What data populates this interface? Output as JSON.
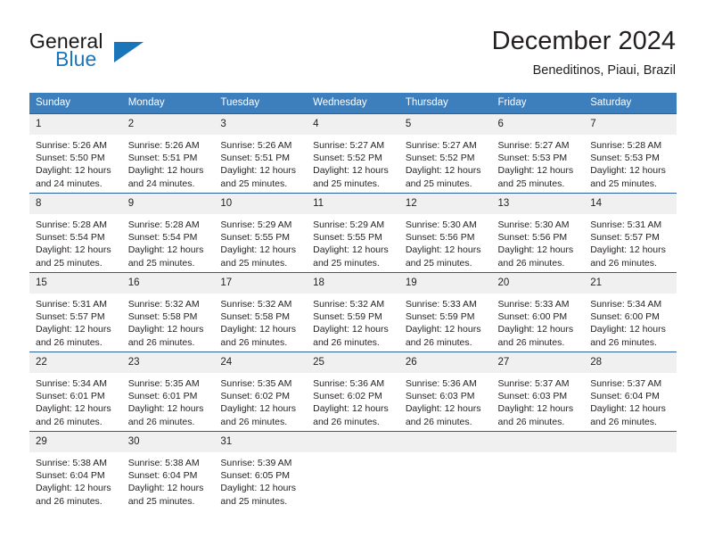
{
  "brand": {
    "name_part1": "General",
    "name_part2": "Blue",
    "triangle_color": "#1b75bb"
  },
  "header": {
    "title": "December 2024",
    "location": "Beneditinos, Piaui, Brazil"
  },
  "theme": {
    "header_row_bg": "#3d7ebd",
    "row_divider": "#2a6099",
    "daynum_bg": "#f0f0f0",
    "text": "#231f20"
  },
  "weekday_headers": [
    "Sunday",
    "Monday",
    "Tuesday",
    "Wednesday",
    "Thursday",
    "Friday",
    "Saturday"
  ],
  "weeks": [
    [
      {
        "day": "1",
        "sunrise": "Sunrise: 5:26 AM",
        "sunset": "Sunset: 5:50 PM",
        "daylight_line1": "Daylight: 12 hours",
        "daylight_line2": "and 24 minutes."
      },
      {
        "day": "2",
        "sunrise": "Sunrise: 5:26 AM",
        "sunset": "Sunset: 5:51 PM",
        "daylight_line1": "Daylight: 12 hours",
        "daylight_line2": "and 24 minutes."
      },
      {
        "day": "3",
        "sunrise": "Sunrise: 5:26 AM",
        "sunset": "Sunset: 5:51 PM",
        "daylight_line1": "Daylight: 12 hours",
        "daylight_line2": "and 25 minutes."
      },
      {
        "day": "4",
        "sunrise": "Sunrise: 5:27 AM",
        "sunset": "Sunset: 5:52 PM",
        "daylight_line1": "Daylight: 12 hours",
        "daylight_line2": "and 25 minutes."
      },
      {
        "day": "5",
        "sunrise": "Sunrise: 5:27 AM",
        "sunset": "Sunset: 5:52 PM",
        "daylight_line1": "Daylight: 12 hours",
        "daylight_line2": "and 25 minutes."
      },
      {
        "day": "6",
        "sunrise": "Sunrise: 5:27 AM",
        "sunset": "Sunset: 5:53 PM",
        "daylight_line1": "Daylight: 12 hours",
        "daylight_line2": "and 25 minutes."
      },
      {
        "day": "7",
        "sunrise": "Sunrise: 5:28 AM",
        "sunset": "Sunset: 5:53 PM",
        "daylight_line1": "Daylight: 12 hours",
        "daylight_line2": "and 25 minutes."
      }
    ],
    [
      {
        "day": "8",
        "sunrise": "Sunrise: 5:28 AM",
        "sunset": "Sunset: 5:54 PM",
        "daylight_line1": "Daylight: 12 hours",
        "daylight_line2": "and 25 minutes."
      },
      {
        "day": "9",
        "sunrise": "Sunrise: 5:28 AM",
        "sunset": "Sunset: 5:54 PM",
        "daylight_line1": "Daylight: 12 hours",
        "daylight_line2": "and 25 minutes."
      },
      {
        "day": "10",
        "sunrise": "Sunrise: 5:29 AM",
        "sunset": "Sunset: 5:55 PM",
        "daylight_line1": "Daylight: 12 hours",
        "daylight_line2": "and 25 minutes."
      },
      {
        "day": "11",
        "sunrise": "Sunrise: 5:29 AM",
        "sunset": "Sunset: 5:55 PM",
        "daylight_line1": "Daylight: 12 hours",
        "daylight_line2": "and 25 minutes."
      },
      {
        "day": "12",
        "sunrise": "Sunrise: 5:30 AM",
        "sunset": "Sunset: 5:56 PM",
        "daylight_line1": "Daylight: 12 hours",
        "daylight_line2": "and 25 minutes."
      },
      {
        "day": "13",
        "sunrise": "Sunrise: 5:30 AM",
        "sunset": "Sunset: 5:56 PM",
        "daylight_line1": "Daylight: 12 hours",
        "daylight_line2": "and 26 minutes."
      },
      {
        "day": "14",
        "sunrise": "Sunrise: 5:31 AM",
        "sunset": "Sunset: 5:57 PM",
        "daylight_line1": "Daylight: 12 hours",
        "daylight_line2": "and 26 minutes."
      }
    ],
    [
      {
        "day": "15",
        "sunrise": "Sunrise: 5:31 AM",
        "sunset": "Sunset: 5:57 PM",
        "daylight_line1": "Daylight: 12 hours",
        "daylight_line2": "and 26 minutes."
      },
      {
        "day": "16",
        "sunrise": "Sunrise: 5:32 AM",
        "sunset": "Sunset: 5:58 PM",
        "daylight_line1": "Daylight: 12 hours",
        "daylight_line2": "and 26 minutes."
      },
      {
        "day": "17",
        "sunrise": "Sunrise: 5:32 AM",
        "sunset": "Sunset: 5:58 PM",
        "daylight_line1": "Daylight: 12 hours",
        "daylight_line2": "and 26 minutes."
      },
      {
        "day": "18",
        "sunrise": "Sunrise: 5:32 AM",
        "sunset": "Sunset: 5:59 PM",
        "daylight_line1": "Daylight: 12 hours",
        "daylight_line2": "and 26 minutes."
      },
      {
        "day": "19",
        "sunrise": "Sunrise: 5:33 AM",
        "sunset": "Sunset: 5:59 PM",
        "daylight_line1": "Daylight: 12 hours",
        "daylight_line2": "and 26 minutes."
      },
      {
        "day": "20",
        "sunrise": "Sunrise: 5:33 AM",
        "sunset": "Sunset: 6:00 PM",
        "daylight_line1": "Daylight: 12 hours",
        "daylight_line2": "and 26 minutes."
      },
      {
        "day": "21",
        "sunrise": "Sunrise: 5:34 AM",
        "sunset": "Sunset: 6:00 PM",
        "daylight_line1": "Daylight: 12 hours",
        "daylight_line2": "and 26 minutes."
      }
    ],
    [
      {
        "day": "22",
        "sunrise": "Sunrise: 5:34 AM",
        "sunset": "Sunset: 6:01 PM",
        "daylight_line1": "Daylight: 12 hours",
        "daylight_line2": "and 26 minutes."
      },
      {
        "day": "23",
        "sunrise": "Sunrise: 5:35 AM",
        "sunset": "Sunset: 6:01 PM",
        "daylight_line1": "Daylight: 12 hours",
        "daylight_line2": "and 26 minutes."
      },
      {
        "day": "24",
        "sunrise": "Sunrise: 5:35 AM",
        "sunset": "Sunset: 6:02 PM",
        "daylight_line1": "Daylight: 12 hours",
        "daylight_line2": "and 26 minutes."
      },
      {
        "day": "25",
        "sunrise": "Sunrise: 5:36 AM",
        "sunset": "Sunset: 6:02 PM",
        "daylight_line1": "Daylight: 12 hours",
        "daylight_line2": "and 26 minutes."
      },
      {
        "day": "26",
        "sunrise": "Sunrise: 5:36 AM",
        "sunset": "Sunset: 6:03 PM",
        "daylight_line1": "Daylight: 12 hours",
        "daylight_line2": "and 26 minutes."
      },
      {
        "day": "27",
        "sunrise": "Sunrise: 5:37 AM",
        "sunset": "Sunset: 6:03 PM",
        "daylight_line1": "Daylight: 12 hours",
        "daylight_line2": "and 26 minutes."
      },
      {
        "day": "28",
        "sunrise": "Sunrise: 5:37 AM",
        "sunset": "Sunset: 6:04 PM",
        "daylight_line1": "Daylight: 12 hours",
        "daylight_line2": "and 26 minutes."
      }
    ],
    [
      {
        "day": "29",
        "sunrise": "Sunrise: 5:38 AM",
        "sunset": "Sunset: 6:04 PM",
        "daylight_line1": "Daylight: 12 hours",
        "daylight_line2": "and 26 minutes."
      },
      {
        "day": "30",
        "sunrise": "Sunrise: 5:38 AM",
        "sunset": "Sunset: 6:04 PM",
        "daylight_line1": "Daylight: 12 hours",
        "daylight_line2": "and 25 minutes."
      },
      {
        "day": "31",
        "sunrise": "Sunrise: 5:39 AM",
        "sunset": "Sunset: 6:05 PM",
        "daylight_line1": "Daylight: 12 hours",
        "daylight_line2": "and 25 minutes."
      },
      {
        "day": "",
        "sunrise": "",
        "sunset": "",
        "daylight_line1": "",
        "daylight_line2": ""
      },
      {
        "day": "",
        "sunrise": "",
        "sunset": "",
        "daylight_line1": "",
        "daylight_line2": ""
      },
      {
        "day": "",
        "sunrise": "",
        "sunset": "",
        "daylight_line1": "",
        "daylight_line2": ""
      },
      {
        "day": "",
        "sunrise": "",
        "sunset": "",
        "daylight_line1": "",
        "daylight_line2": ""
      }
    ]
  ]
}
